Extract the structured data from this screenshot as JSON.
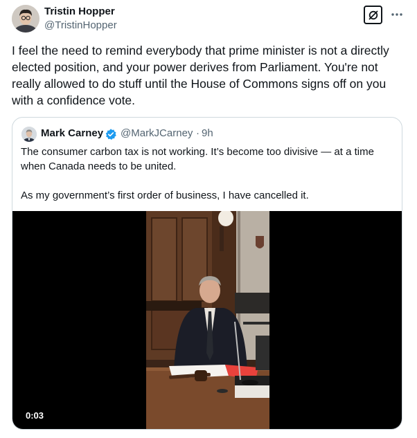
{
  "post": {
    "author_name": "Tristin Hopper",
    "author_handle": "@TristinHopper",
    "text": "I feel the need to remind everybody that prime minister is not a directly elected position, and your power derives from Parliament. You're not really allowed to do stuff until the House of Commons signs off on you with a confidence vote."
  },
  "quote": {
    "author_name": "Mark Carney",
    "author_handle": "@MarkJCarney",
    "separator": "·",
    "time": "9h",
    "paragraphs": [
      "The consumer carbon tax is not working. It’s become too divisive — at a time when Canada needs to be united.",
      "As my government’s first order of business, I have cancelled it."
    ],
    "video_timestamp": "0:03"
  },
  "icons": {
    "grok": "grok-slash-icon",
    "more": "more-dots-icon",
    "verified": "verified-badge-icon"
  },
  "colors": {
    "text": "#0f1419",
    "secondary": "#536471",
    "border": "#cfd9de",
    "verified": "#1d9bf0"
  }
}
